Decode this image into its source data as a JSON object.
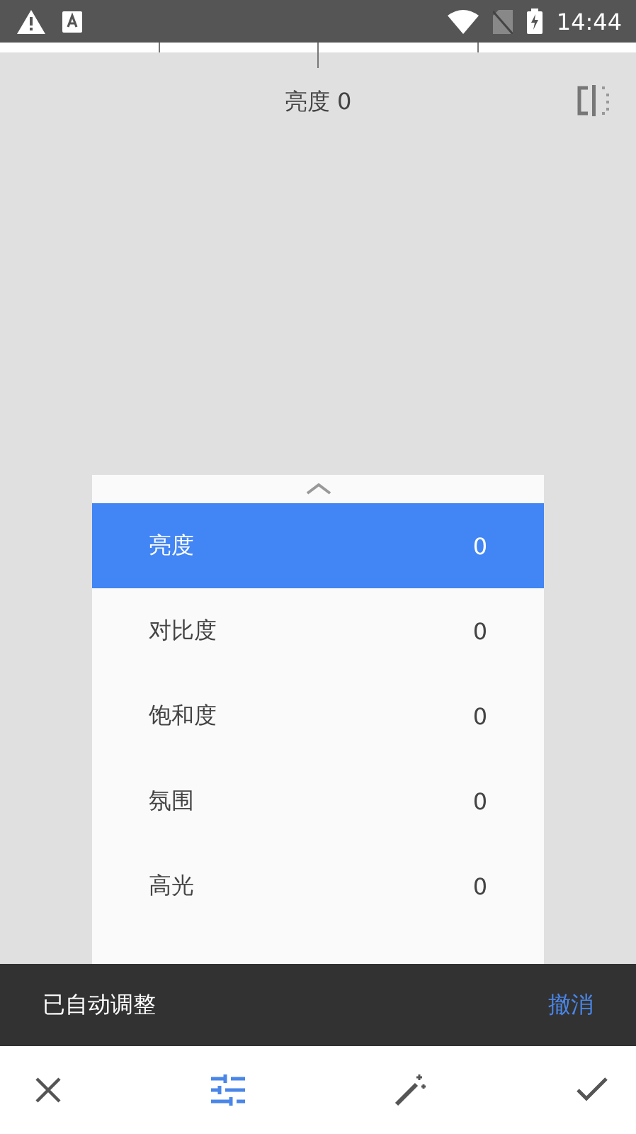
{
  "status_bar": {
    "time": "14:44"
  },
  "adjustment_label": "亮度 0",
  "adjustments": [
    {
      "name": "亮度",
      "value": "0",
      "selected": true
    },
    {
      "name": "对比度",
      "value": "0",
      "selected": false
    },
    {
      "name": "饱和度",
      "value": "0",
      "selected": false
    },
    {
      "name": "氛围",
      "value": "0",
      "selected": false
    },
    {
      "name": "高光",
      "value": "0",
      "selected": false
    }
  ],
  "snackbar": {
    "message": "已自动调整",
    "action": "撤消"
  },
  "bottom_bar": {
    "tools": [
      {
        "kind": "close",
        "selected": false
      },
      {
        "kind": "tune",
        "selected": true
      },
      {
        "kind": "auto",
        "selected": false
      },
      {
        "kind": "apply",
        "selected": false
      }
    ]
  }
}
